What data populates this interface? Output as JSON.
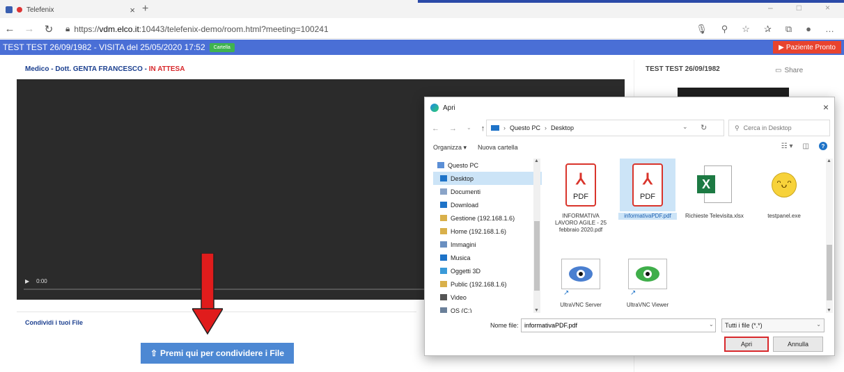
{
  "browser": {
    "tab_title": "Telefenix",
    "url_prefix": "https://",
    "url_host": "vdm.elco.it",
    "url_path": ":10443/telefenix-demo/room.html?meeting=100241"
  },
  "app": {
    "header_title": "TEST TEST 26/09/1982 - VISITA del 25/05/2020 17:52",
    "cartella_label": "Cartella",
    "pronto_label": "Paziente Pronto",
    "medico_prefix": "Medico - Dott. GENTA FRANCESCO - ",
    "medico_status": "IN ATTESA",
    "video_time": "0:00",
    "share_title": "Condividi i tuoi File",
    "share_button": "Premi qui per condividere i File",
    "right_title": "TEST TEST 26/09/1982",
    "right_share": "Share"
  },
  "dialog": {
    "title": "Apri",
    "path": [
      "Questo PC",
      "Desktop"
    ],
    "search_placeholder": "Cerca in Desktop",
    "organizza": "Organizza ▾",
    "nuova_cartella": "Nuova cartella",
    "nav_items": [
      {
        "label": "Questo PC",
        "icon_color": "#5b8fd6"
      },
      {
        "label": "Desktop",
        "icon_color": "#1e73c8"
      },
      {
        "label": "Documenti",
        "icon_color": "#8aa4c8"
      },
      {
        "label": "Download",
        "icon_color": "#1e73c8"
      },
      {
        "label": "Gestione (192.168.1.6)",
        "icon_color": "#d9b04a"
      },
      {
        "label": "Home (192.168.1.6)",
        "icon_color": "#d9b04a"
      },
      {
        "label": "Immagini",
        "icon_color": "#6a8fc0"
      },
      {
        "label": "Musica",
        "icon_color": "#1e73c8"
      },
      {
        "label": "Oggetti 3D",
        "icon_color": "#3a9ad9"
      },
      {
        "label": "Public (192.168.1.6)",
        "icon_color": "#d9b04a"
      },
      {
        "label": "Video",
        "icon_color": "#555555"
      },
      {
        "label": "OS (C:)",
        "icon_color": "#6a7f99"
      }
    ],
    "files": [
      {
        "name": "INFORMATIVA LAVORO AGILE - 25 febbraio 2020.pdf",
        "pdf_text": "PDF"
      },
      {
        "name": "informativaPDF.pdf",
        "pdf_text": "PDF"
      },
      {
        "name": "Richieste Televisita.xlsx"
      },
      {
        "name": "testpanel.exe"
      },
      {
        "name": "UltraVNC Server"
      },
      {
        "name": "UltraVNC Viewer"
      }
    ],
    "filename_label": "Nome file:",
    "filename_value": "informativaPDF.pdf",
    "filetype": "Tutti i file (*.*)",
    "open_button": "Apri",
    "cancel_button": "Annulla"
  },
  "colors": {
    "app_header": "#4a6fd6",
    "pronto": "#e8432e",
    "share_button": "#4d88d3",
    "highlight": "#d8282b",
    "selection": "#cce4f7"
  }
}
